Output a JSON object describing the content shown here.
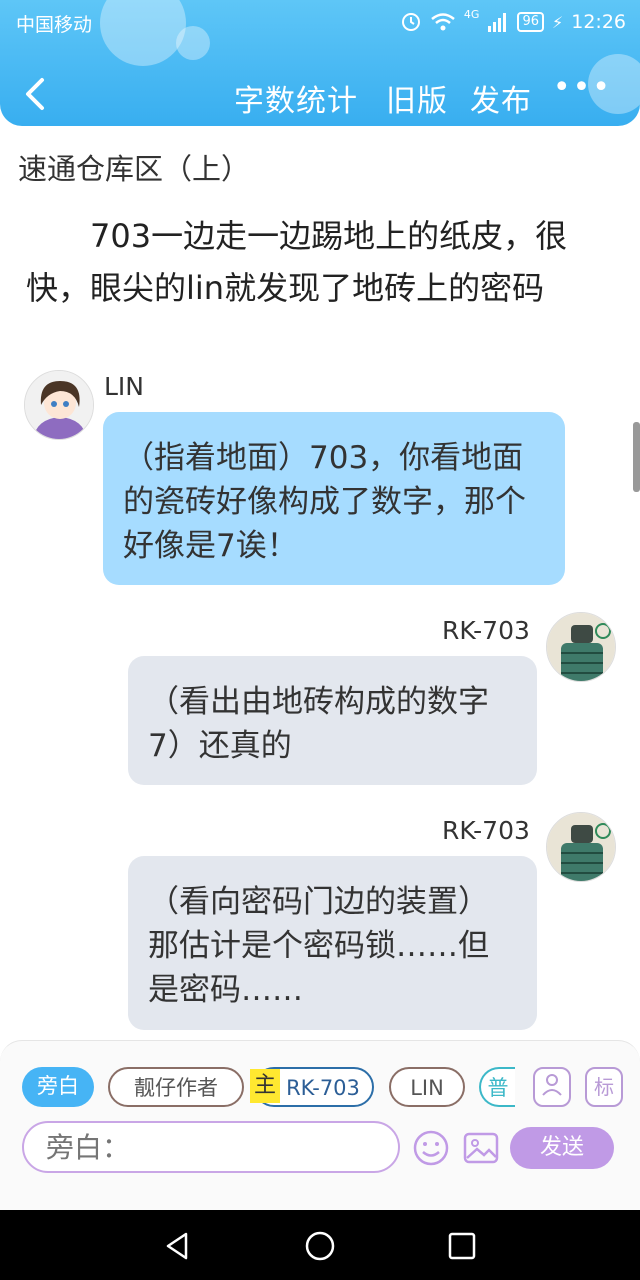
{
  "status_bar": {
    "carrier": "中国移动",
    "network": "4G",
    "battery": "96",
    "time": "12:26"
  },
  "header": {
    "word_count_label": "字数统计",
    "old_version_label": "旧版",
    "publish_label": "发布",
    "more_label": "•••"
  },
  "story": {
    "section_title": "速通仓库区（上）",
    "narration": "703一边走一边踢地上的纸皮，很快，眼尖的lin就发现了地砖上的密码"
  },
  "messages": [
    {
      "speaker": "LIN",
      "text": "（指着地面）703，你看地面的瓷砖好像构成了数字，那个好像是7诶！"
    },
    {
      "speaker": "RK-703",
      "text": "（看出由地砖构成的数字7）还真的"
    },
    {
      "speaker": "RK-703",
      "text": "（看向密码门边的装置）那估计是个密码锁……但是密码……"
    }
  ],
  "composer": {
    "chips": {
      "narrator": "旁白",
      "author": "靓仔作者",
      "host_mark": "主",
      "rk703": "RK-703",
      "lin": "LIN",
      "more": "普"
    },
    "tag_button": "标",
    "input_placeholder": "旁白：",
    "send_label": "发送"
  },
  "colors": {
    "header_blue": "#38aef0",
    "left_bubble": "#a6dcff",
    "right_bubble": "#e3e7ee",
    "accent_purple": "#c09ae6"
  }
}
